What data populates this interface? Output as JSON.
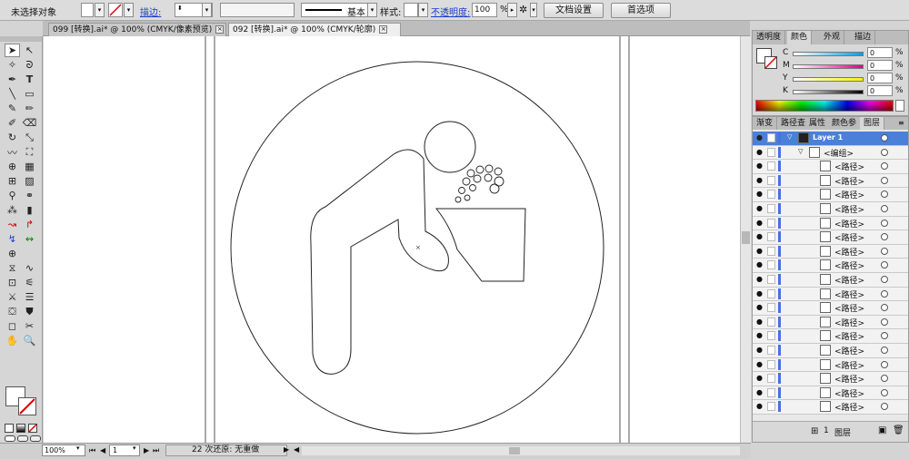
{
  "control_bar": {
    "selection_status": "未选择对象",
    "stroke_label": "描边:",
    "stroke_profile": "基本",
    "style_label": "样式:",
    "opacity_label": "不透明度:",
    "opacity_value": "100",
    "opacity_unit": "%",
    "doc_setup_button": "文档设置",
    "preferences_button": "首选项"
  },
  "document_tabs": [
    {
      "label": "099 [转换].ai* @ 100% (CMYK/像素预览)",
      "active": false
    },
    {
      "label": "092 [转换].ai* @ 100% (CMYK/轮廓)",
      "active": true
    }
  ],
  "color_panel": {
    "tabs": [
      "透明度",
      "颜色",
      "外观",
      "描边"
    ],
    "channels": [
      {
        "name": "C",
        "value": "0",
        "percent": "%",
        "gradient": [
          "#ffffff",
          "#00a0e9"
        ]
      },
      {
        "name": "M",
        "value": "0",
        "percent": "%",
        "gradient": [
          "#ffffff",
          "#e4007f"
        ]
      },
      {
        "name": "Y",
        "value": "0",
        "percent": "%",
        "gradient": [
          "#ffffff",
          "#fff100"
        ]
      },
      {
        "name": "K",
        "value": "0",
        "percent": "%",
        "gradient": [
          "#ffffff",
          "#000000"
        ]
      }
    ]
  },
  "layers_panel": {
    "tabs": [
      "渐变",
      "路径查",
      "属性",
      "颜色参",
      "图层"
    ],
    "top_layer": "Layer 1",
    "group": "<编组>",
    "paths": [
      "<路径>",
      "<路径>",
      "<路径>",
      "<路径>",
      "<路径>",
      "<路径>",
      "<路径>",
      "<路径>",
      "<路径>",
      "<路径>",
      "<路径>",
      "<路径>",
      "<路径>",
      "<路径>",
      "<路径>",
      "<路径>",
      "<路径>",
      "<路径>"
    ],
    "bottom_label": "图层",
    "bottom_count": "1"
  },
  "status_bar": {
    "zoom": "100%",
    "artboard": "1",
    "undo_status": "22 次还原: 无重做"
  },
  "colors": {
    "accent": "#1a3cc8",
    "layer_selected": "#4a80d8"
  }
}
